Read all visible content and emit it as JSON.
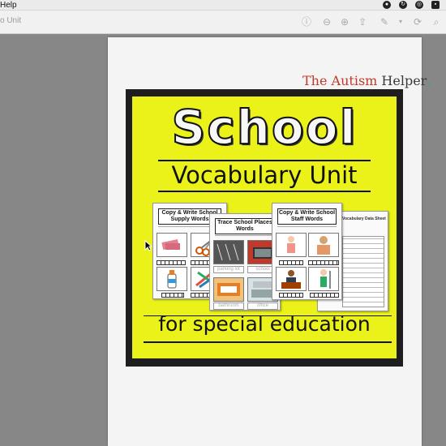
{
  "menubar": {
    "app_name": "Help",
    "icons": [
      "record-icon",
      "sync-icon",
      "globe-icon",
      "box-icon"
    ]
  },
  "toolbar": {
    "document_title": "o Unit",
    "tools": [
      "info-icon",
      "zoom-out-icon",
      "zoom-in-icon",
      "share-icon",
      "markup-icon",
      "chevron-down-icon",
      "rotate-icon",
      "search-icon"
    ]
  },
  "page": {
    "brand": {
      "part1": "The Autism",
      "part2": " Helper",
      "part3": "."
    },
    "cover": {
      "title": "School",
      "subtitle": "Vocabulary Unit",
      "footer": "for special education",
      "colors": {
        "background": "#eaf21a",
        "frame": "#1e1e1e"
      }
    },
    "worksheets": [
      {
        "title": "Copy & Write School Supply Words"
      },
      {
        "title": "Trace School Places Words",
        "traces": [
          "parking lot",
          "school",
          "bathroom",
          "office"
        ]
      },
      {
        "title": "Copy & Write School Staff Words"
      },
      {
        "title": "Vocabulary Data Sheet"
      }
    ]
  }
}
